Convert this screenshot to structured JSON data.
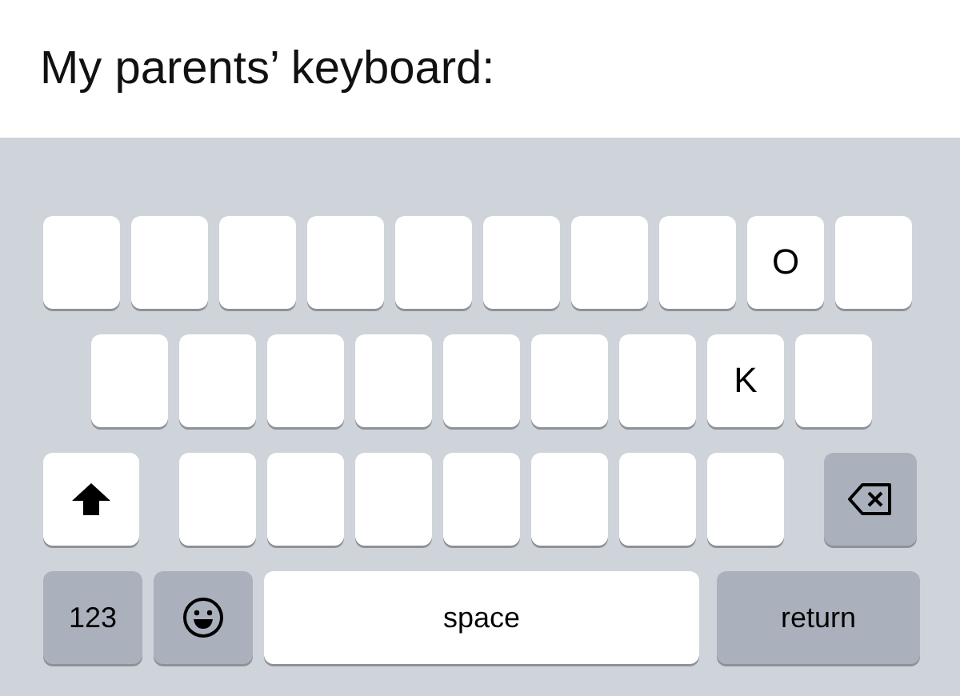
{
  "caption": "My parents’ keyboard:",
  "keyboard": {
    "rows": [
      {
        "keys": [
          {
            "kind": "blank"
          },
          {
            "kind": "blank"
          },
          {
            "kind": "blank"
          },
          {
            "kind": "blank"
          },
          {
            "kind": "blank"
          },
          {
            "kind": "blank"
          },
          {
            "kind": "blank"
          },
          {
            "kind": "blank"
          },
          {
            "kind": "letter",
            "label": "O"
          },
          {
            "kind": "blank"
          }
        ]
      },
      {
        "keys": [
          {
            "kind": "blank"
          },
          {
            "kind": "blank"
          },
          {
            "kind": "blank"
          },
          {
            "kind": "blank"
          },
          {
            "kind": "blank"
          },
          {
            "kind": "blank"
          },
          {
            "kind": "blank"
          },
          {
            "kind": "letter",
            "label": "K"
          },
          {
            "kind": "blank"
          }
        ]
      },
      {
        "keys": [
          {
            "kind": "shift"
          },
          {
            "kind": "blank"
          },
          {
            "kind": "blank"
          },
          {
            "kind": "blank"
          },
          {
            "kind": "blank"
          },
          {
            "kind": "blank"
          },
          {
            "kind": "blank"
          },
          {
            "kind": "blank"
          },
          {
            "kind": "delete"
          }
        ]
      },
      {
        "keys": [
          {
            "kind": "numbers",
            "label": "123"
          },
          {
            "kind": "emoji"
          },
          {
            "kind": "space",
            "label": "space"
          },
          {
            "kind": "return",
            "label": "return"
          }
        ]
      }
    ]
  }
}
